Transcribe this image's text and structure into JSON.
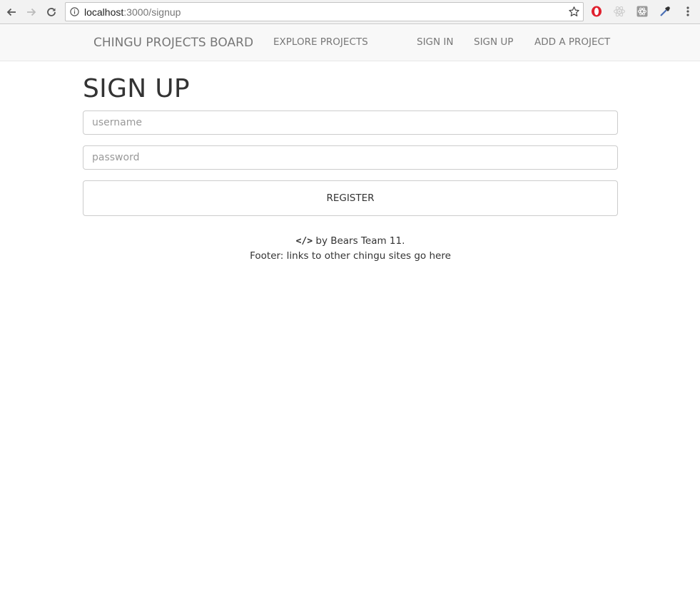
{
  "browser": {
    "url_host": "localhost",
    "url_path": ":3000/signup",
    "icons": [
      "back-arrow-icon",
      "forward-arrow-icon",
      "reload-icon",
      "info-icon",
      "star-icon",
      "opera-icon",
      "react-devtools-icon",
      "extension-icon",
      "eyedropper-icon",
      "menu-kebab-icon"
    ]
  },
  "navbar": {
    "brand": "CHINGU PROJECTS BOARD",
    "explore": "EXPLORE PROJECTS",
    "sign_in": "SIGN IN",
    "sign_up": "SIGN UP",
    "add_project": "ADD A PROJECT"
  },
  "page": {
    "title": "SIGN UP"
  },
  "form": {
    "username_placeholder": "username",
    "username_value": "",
    "password_placeholder": "password",
    "password_value": "",
    "register_label": "REGISTER"
  },
  "footer": {
    "code_glyph": "</>",
    "credit": " by Bears Team 11.",
    "links_text": "Footer: links to other chingu sites go here"
  },
  "colors": {
    "navbar_bg": "#f8f8f8",
    "nav_text": "#777777",
    "opera_red": "#e0202e"
  }
}
